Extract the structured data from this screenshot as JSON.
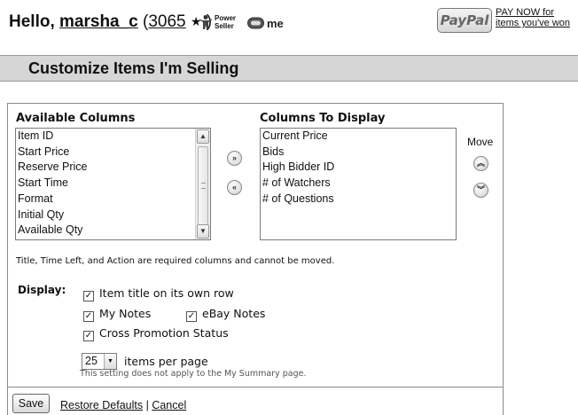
{
  "header": {
    "greeting": "Hello,",
    "username": "marsha_c",
    "feedback_open": "(",
    "feedback_score": "3065",
    "feedback_close": ")",
    "star": "★",
    "power_seller_line1": "Power",
    "power_seller_line2": "Seller",
    "me_badge": "me",
    "paypal_logo": "PayPal",
    "paypal_line1": "PAY NOW for",
    "paypal_line2": "items you've won"
  },
  "page_title": "Customize Items I'm Selling",
  "available_columns": {
    "heading": "Available Columns",
    "items": [
      "Item ID",
      "Start Price",
      "Reserve Price",
      "Start Time",
      "Format",
      "Initial Qty",
      "Available Qty"
    ]
  },
  "display_columns": {
    "heading": "Columns To Display",
    "items": [
      "Current Price",
      "Bids",
      "High Bidder ID",
      "# of Watchers",
      "# of Questions"
    ]
  },
  "move_label": "Move",
  "buttons": {
    "add": "»",
    "remove": "«",
    "move_up": "︽",
    "move_down": "︾",
    "scroll_up": "▲",
    "scroll_down": "▼",
    "select_arrow": "▼",
    "save": "Save"
  },
  "required_note": "Title, Time Left, and Action are required columns and cannot be moved.",
  "display": {
    "label": "Display:",
    "check_mark": "✓",
    "item_title_row": "Item title on its own row",
    "my_notes": "My Notes",
    "ebay_notes": "eBay Notes",
    "cross_promotion": "Cross Promotion Status",
    "items_per_page_value": "25",
    "items_per_page_label": "items per page",
    "items_per_page_hint": "This setting does not apply to the My Summary page."
  },
  "links": {
    "restore_defaults": "Restore Defaults",
    "separator": " | ",
    "cancel": "Cancel"
  },
  "icons": {
    "power_seller": "power-seller-icon",
    "me": "me-page-icon",
    "star": "feedback-star-icon"
  }
}
